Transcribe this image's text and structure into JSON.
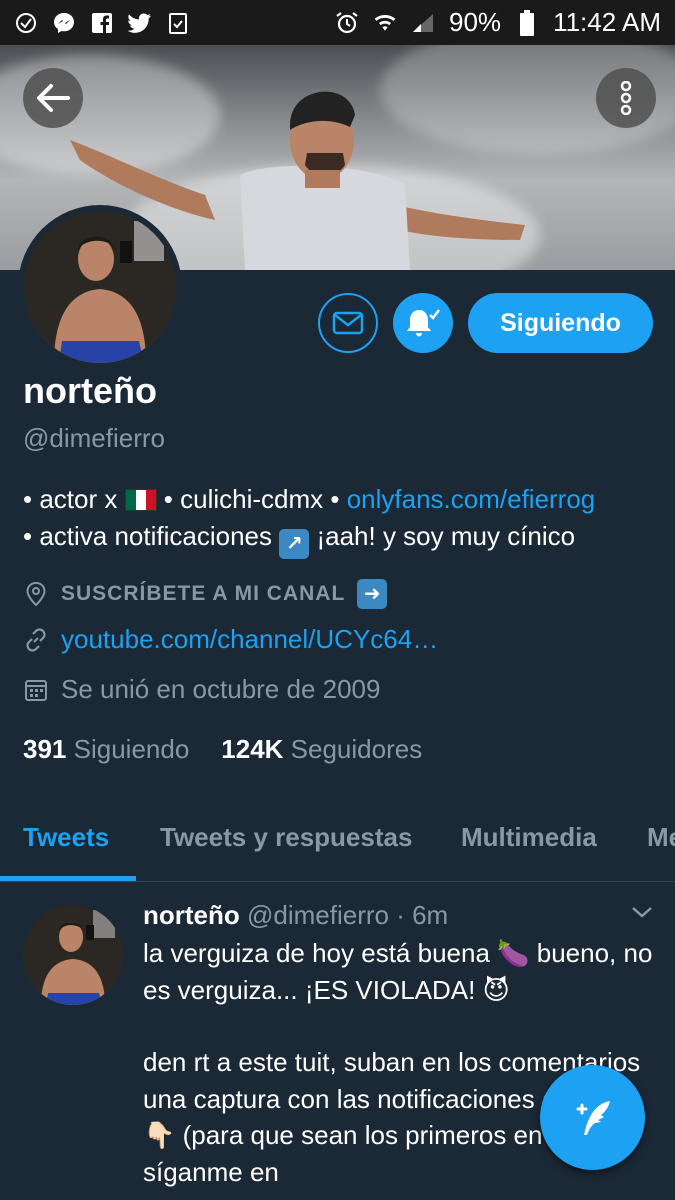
{
  "status_bar": {
    "battery": "90%",
    "time": "11:42 AM",
    "left_icons": [
      "check-circle-icon",
      "messenger-icon",
      "facebook-icon",
      "twitter-icon",
      "clipboard-check-icon"
    ],
    "right_icons": [
      "alarm-icon",
      "wifi-icon",
      "signal-icon",
      "battery-icon"
    ]
  },
  "profile": {
    "name": "norteño",
    "handle": "@dimefierro",
    "bio_line1_prefix": "• actor x ",
    "bio_line1_mid": " • culichi-cdmx • ",
    "bio_link": "onlyfans.com/efierrog",
    "bio_line2_prefix": "• activa notificaciones ",
    "bio_line2_suffix": " ¡aah! y soy muy cínico",
    "location": "SUSCRÍBETE A MI CANAL",
    "website": "youtube.com/channel/UCYc64…",
    "joined": "Se unió en octubre de 2009",
    "following_count": "391",
    "following_label": "Siguiendo",
    "followers_count": "124K",
    "followers_label": "Seguidores"
  },
  "actions": {
    "follow_label": "Siguiendo"
  },
  "tabs": [
    {
      "label": "Tweets"
    },
    {
      "label": "Tweets y respuestas"
    },
    {
      "label": "Multimedia"
    },
    {
      "label": "Me"
    }
  ],
  "tweet": {
    "name": "norteño",
    "handle": "@dimefierro",
    "time": "· 6m",
    "para1": "la verguiza de hoy está buena 🍆 bueno, no es verguiza... ¡ES VIOLADA! 😈",
    "para2": "den rt a este tuit, suban en los comentarios una captura con las notificaciones activas 👇🏻 (para que sean los primeros en verlo) y síganme en"
  },
  "colors": {
    "accent": "#1da1f2",
    "background": "#1b2836",
    "muted": "#8899a6"
  }
}
